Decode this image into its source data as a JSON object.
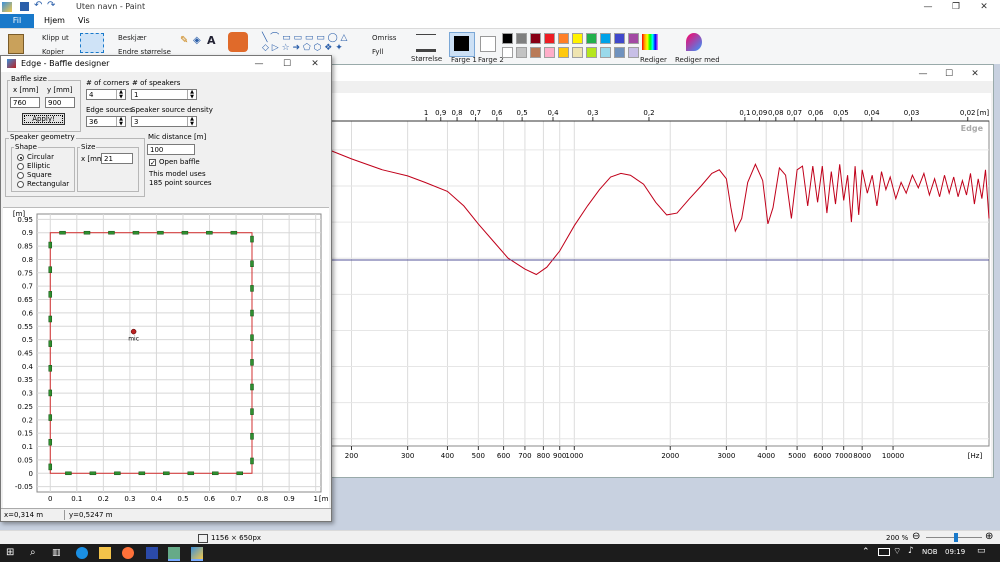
{
  "paint": {
    "title": "Uten navn - Paint",
    "menu": {
      "file": "Fil",
      "home": "Hjem",
      "view": "Vis"
    },
    "ribbon": {
      "cut": "Klipp ut",
      "copy": "Kopier",
      "crop": "Beskjær",
      "resize": "Endre størrelse",
      "outline": "Omriss",
      "fill": "Fyll",
      "size": "Størrelse",
      "color1": "Farge 1",
      "color2": "Farge 2",
      "edit_colors": "Rediger farger",
      "edit_with": "Rediger med Paint 3D"
    },
    "palette_row1": [
      "#000000",
      "#7f7f7f",
      "#880015",
      "#ed1c24",
      "#ff7f27",
      "#fff200",
      "#22b14c",
      "#00a2e8",
      "#3f48cc",
      "#a349a4"
    ],
    "palette_row2": [
      "#ffffff",
      "#c3c3c3",
      "#b97a57",
      "#ffaec9",
      "#ffc90e",
      "#efe4b0",
      "#b5e61d",
      "#99d9ea",
      "#7092be",
      "#c8bfe7"
    ],
    "status": {
      "dimensions": "1156 × 650px",
      "zoom": "200 %"
    }
  },
  "edge_main": {
    "logo": "Edge"
  },
  "baffle": {
    "title": "Edge - Baffle designer",
    "baffle_size_label": "Baffle size",
    "x_label": "x [mm]",
    "y_label": "y [mm]",
    "x_value": "760",
    "y_value": "900",
    "apply": "Apply!",
    "corners_label": "# of corners",
    "corners_value": "4",
    "speakers_label": "# of speakers",
    "speakers_value": "1",
    "edge_sources_label": "Edge sources",
    "edge_sources_value": "36",
    "density_label": "Speaker source density",
    "density_value": "3",
    "geometry_label": "Speaker geometry",
    "shape_label": "Shape",
    "shapes": [
      "Circular",
      "Elliptic",
      "Square",
      "Rectangular"
    ],
    "size_label": "Size",
    "size_x_label": "x [mm]",
    "size_value": "21",
    "mic_label": "Mic distance [m]",
    "mic_value": "100",
    "open_baffle": "Open baffle",
    "model_line1": "This model uses",
    "model_line2": "185 point sources",
    "mic_marker": "mic",
    "status_x": "x=0,314 m",
    "status_y": "y=0,5247 m"
  },
  "chart_data": [
    {
      "type": "line",
      "x_axis_top_label": "[m]",
      "top_ticks": [
        "1",
        "0,9",
        "0,8",
        "0,7",
        "0,6",
        "0,5",
        "0,4",
        "0,3",
        "0,2",
        "0,1",
        "0,09",
        "0,08",
        "0,07",
        "0,06",
        "0,05",
        "0,04",
        "0,03",
        "0,02"
      ],
      "xlabel": "[Hz]",
      "x_ticks": [
        200,
        300,
        400,
        500,
        600,
        700,
        800,
        900,
        1000,
        2000,
        3000,
        4000,
        5000,
        6000,
        7000,
        8000,
        10000
      ],
      "scale": "log",
      "xlim": [
        170,
        20000
      ],
      "series": [
        {
          "color": "#c0001a",
          "values": [
            [
              170,
              1.0
            ],
            [
              200,
              0.75
            ],
            [
              250,
              0.45
            ],
            [
              300,
              0.28
            ],
            [
              340,
              0.1
            ],
            [
              400,
              -0.15
            ],
            [
              450,
              -0.55
            ],
            [
              500,
              -1.05
            ],
            [
              560,
              -1.55
            ],
            [
              620,
              -2.0
            ],
            [
              700,
              -2.3
            ],
            [
              760,
              -2.45
            ],
            [
              820,
              -2.25
            ],
            [
              900,
              -1.8
            ],
            [
              1000,
              -1.1
            ],
            [
              1100,
              -0.55
            ],
            [
              1200,
              -0.1
            ],
            [
              1300,
              0.25
            ],
            [
              1400,
              0.35
            ],
            [
              1500,
              0.3
            ],
            [
              1650,
              0.05
            ],
            [
              1800,
              -0.45
            ],
            [
              1950,
              -0.8
            ],
            [
              2100,
              -0.75
            ],
            [
              2300,
              -0.35
            ],
            [
              2500,
              0.0
            ],
            [
              2700,
              0.35
            ],
            [
              2850,
              0.45
            ],
            [
              3000,
              0.2
            ],
            [
              3100,
              -0.6
            ],
            [
              3200,
              -1.25
            ],
            [
              3350,
              -0.9
            ],
            [
              3500,
              0.1
            ],
            [
              3700,
              0.6
            ],
            [
              3900,
              0.15
            ],
            [
              4050,
              -1.05
            ],
            [
              4200,
              -0.6
            ],
            [
              4400,
              0.5
            ],
            [
              4600,
              0.3
            ],
            [
              4800,
              -0.9
            ],
            [
              5000,
              0.45
            ],
            [
              5200,
              0.55
            ],
            [
              5400,
              -0.55
            ],
            [
              5600,
              0.55
            ],
            [
              5800,
              -0.45
            ],
            [
              6000,
              0.55
            ],
            [
              6200,
              -0.75
            ],
            [
              6400,
              0.4
            ],
            [
              6600,
              -0.5
            ],
            [
              6800,
              0.6
            ],
            [
              7000,
              -0.4
            ],
            [
              7200,
              0.3
            ],
            [
              7400,
              -1.0
            ],
            [
              7600,
              0.55
            ],
            [
              7800,
              -0.8
            ],
            [
              8000,
              0.45
            ],
            [
              8300,
              -0.2
            ],
            [
              8600,
              0.3
            ],
            [
              8900,
              -0.55
            ],
            [
              9200,
              0.4
            ],
            [
              9500,
              -0.1
            ],
            [
              9800,
              0.25
            ],
            [
              10200,
              -0.35
            ],
            [
              10600,
              0.1
            ],
            [
              11000,
              -0.2
            ],
            [
              11500,
              0.3
            ],
            [
              12000,
              -0.05
            ],
            [
              12500,
              0.35
            ],
            [
              13000,
              -0.25
            ],
            [
              13500,
              0.2
            ],
            [
              14000,
              -0.3
            ],
            [
              14500,
              0.3
            ],
            [
              15000,
              -0.2
            ],
            [
              15500,
              0.25
            ],
            [
              16000,
              -0.3
            ],
            [
              16500,
              0.15
            ],
            [
              17000,
              -0.25
            ],
            [
              17500,
              0.35
            ],
            [
              18000,
              -0.5
            ],
            [
              18500,
              0.2
            ],
            [
              19000,
              -0.35
            ],
            [
              19500,
              0.45
            ],
            [
              20000,
              -0.9
            ]
          ]
        },
        {
          "color": "#55559a",
          "values": [
            [
              170,
              -2.05
            ],
            [
              20000,
              -2.05
            ]
          ]
        }
      ],
      "ylim": [
        -7.2,
        1.8
      ]
    },
    {
      "type": "scatter",
      "xlabel": "[m]",
      "ylabel": "[m]",
      "x_ticks": [
        0,
        0.1,
        0.2,
        0.3,
        0.4,
        0.5,
        0.6,
        0.7,
        0.8,
        0.9,
        1
      ],
      "y_ticks": [
        0.95,
        0.9,
        0.85,
        0.8,
        0.75,
        0.7,
        0.65,
        0.6,
        0.55,
        0.5,
        0.45,
        0.4,
        0.35,
        0.3,
        0.25,
        0.2,
        0.15,
        0.1,
        0.05,
        0,
        -0.05
      ],
      "xlim": [
        -0.05,
        1.02
      ],
      "ylim": [
        -0.07,
        0.97
      ],
      "baffle_rect": {
        "x": [
          0,
          0.76
        ],
        "y": [
          0,
          0.9
        ]
      },
      "mic": {
        "x": 0.314,
        "y": 0.53
      },
      "edge_source_count": 36
    }
  ]
}
